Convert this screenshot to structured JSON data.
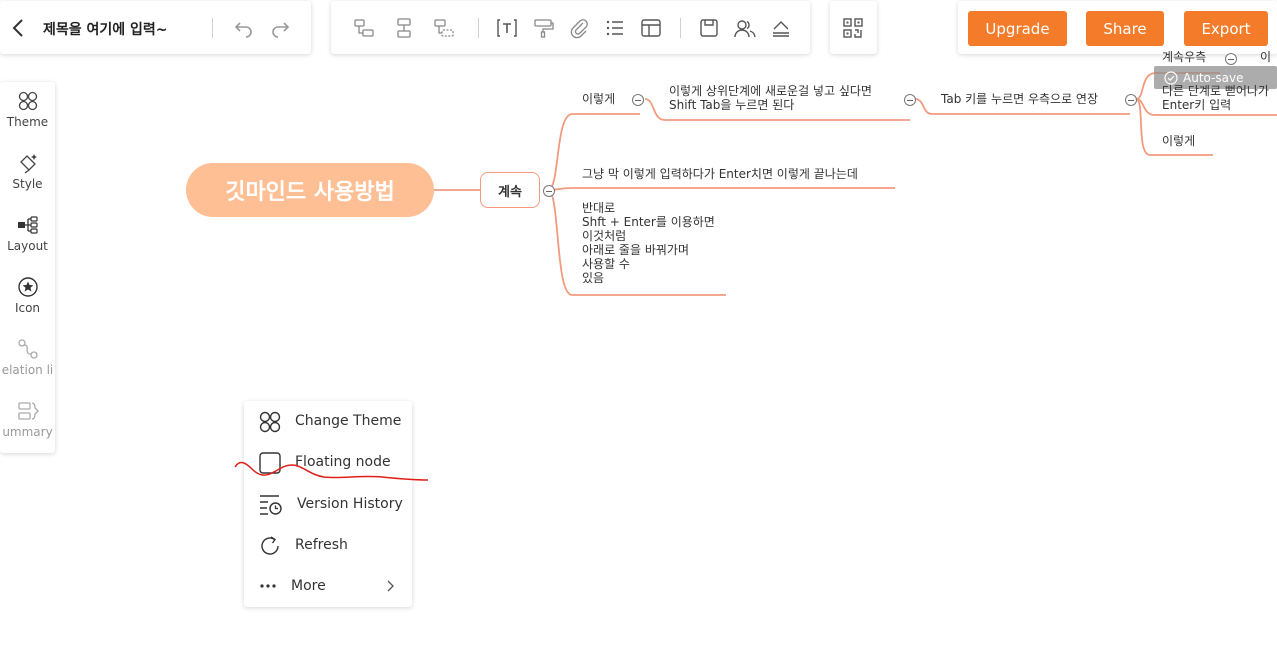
{
  "header": {
    "title": "제목을 여기에 입력~",
    "upgrade_label": "Upgrade",
    "share_label": "Share",
    "export_label": "Export"
  },
  "sidebar": {
    "items": [
      {
        "label": "Theme",
        "icon": "theme-icon"
      },
      {
        "label": "Style",
        "icon": "style-icon"
      },
      {
        "label": "Layout",
        "icon": "layout-icon"
      },
      {
        "label": "Icon",
        "icon": "icon-icon"
      },
      {
        "label": "elation li",
        "icon": "relation-line-icon"
      },
      {
        "label": "ummary",
        "icon": "summary-icon"
      }
    ]
  },
  "mindmap": {
    "root": "깃마인드 사용방법",
    "level1": "계속",
    "nodes": {
      "n1": "이렇게",
      "n2_line1": "이렇게 상위단계에 새로운걸 넣고 싶다면",
      "n2_line2": "Shift Tab을 누르면 된다",
      "n3": "Tab 키를 누르면 우측으로 연장",
      "n4": "계속우측",
      "n5_line1": "다른 단계로 뻗어나가",
      "n5_line2": "Enter키 입력",
      "n6": "이렇게",
      "n7": "그냥 막 이렇게 입력하다가 Enter치면 이렇게 끝나는데",
      "n8_lines": [
        "반대로",
        "Shft + Enter를 이용하면",
        "이것처럼",
        "아래로 줄을 바꿔가며",
        "사용할 수",
        "있음"
      ]
    },
    "autosave": "Auto-save"
  },
  "context_menu": {
    "items": [
      {
        "label": "Change Theme",
        "icon": "change-theme-icon"
      },
      {
        "label": "Floating node",
        "icon": "floating-node-icon"
      },
      {
        "label": "Version History",
        "icon": "version-history-icon"
      },
      {
        "label": "Refresh",
        "icon": "refresh-icon"
      },
      {
        "label": "More",
        "icon": "more-icon"
      }
    ]
  },
  "colors": {
    "accent": "#f47b2a",
    "root_node": "#ffbf95",
    "branch_line": "#f39a7e",
    "annotation": "#e0201a"
  }
}
